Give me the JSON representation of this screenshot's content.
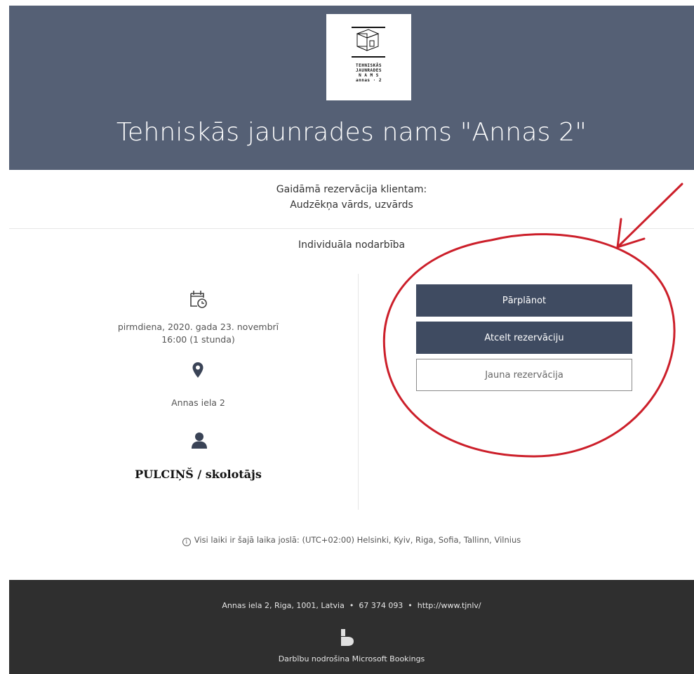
{
  "header": {
    "title": "Tehniskās jaunrades nams \"Annas 2\"",
    "logo_lines": [
      "TEHNISKĀS",
      "JAUNRADES",
      "N A M S",
      "annas · 2"
    ]
  },
  "booking": {
    "customer_heading": "Gaidāmā rezervācija klientam:",
    "customer_name": "Audzēkņa vārds, uzvārds",
    "service": "Individuāla nodarbība",
    "date": "pirmdiena, 2020. gada 23. novembrī",
    "time": "16:00 (1 stunda)",
    "location": "Annas iela 2",
    "staff": "PULCIŅŠ / skolotājs"
  },
  "actions": {
    "reschedule": "Pārplānot",
    "cancel": "Atcelt rezervāciju",
    "new": "Jauna rezervācija"
  },
  "timezone_note": "Visi laiki ir šajā laika joslā: (UTC+02:00) Helsinki, Kyiv, Riga, Sofia, Tallinn, Vilnius",
  "footer": {
    "address": "Annas iela 2, Riga, 1001, Latvia",
    "phone": "67 374 093",
    "website": "http://www.tjnlv/",
    "powered_by": "Darbību nodrošina Microsoft Bookings"
  },
  "icons": {
    "calendar": "calendar-clock-icon",
    "location": "map-pin-icon",
    "person": "person-icon",
    "info": "info-icon",
    "bookings_logo": "microsoft-bookings-icon"
  },
  "colors": {
    "header_bg": "#556075",
    "button_dark": "#3f4b61",
    "footer_bg": "#2f2f2f",
    "annotation_red": "#cc1f2a"
  }
}
